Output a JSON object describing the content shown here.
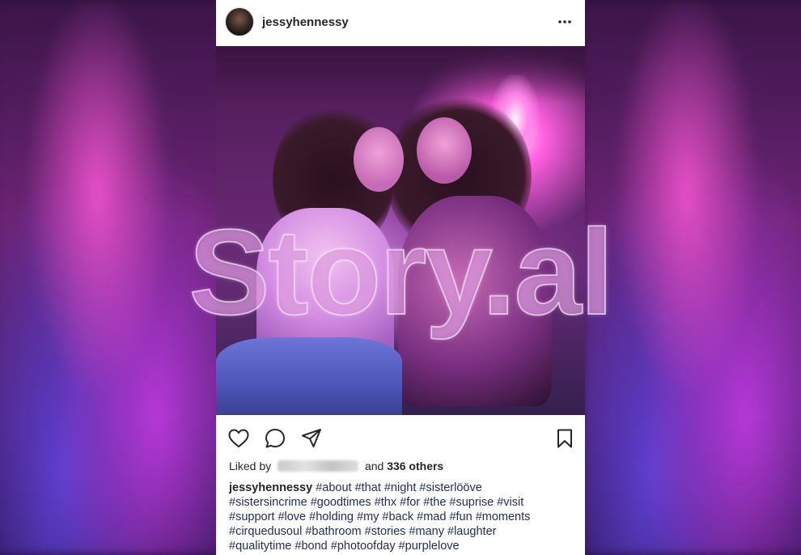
{
  "post": {
    "username": "jessyhennessy",
    "liked_by_prefix": "Liked by",
    "liked_and": "and",
    "liked_count": "336 others",
    "caption_user": "jessyhennessy",
    "caption_lines": [
      " #about #that #night #sisterlööve",
      "#sistersincrime #goodtimes #thx #for #the #suprise #visit",
      "#support #love #holding #my #back #mad #fun #moments",
      "#cirquedusoul #bathroom #stories #many #laughter",
      "#qualitytime #bond #photoofday #purplelove"
    ]
  },
  "watermark": "Story.al",
  "icons": {
    "more": "more-options-icon",
    "like": "heart-icon",
    "comment": "comment-icon",
    "share": "paper-plane-icon",
    "save": "bookmark-icon"
  }
}
